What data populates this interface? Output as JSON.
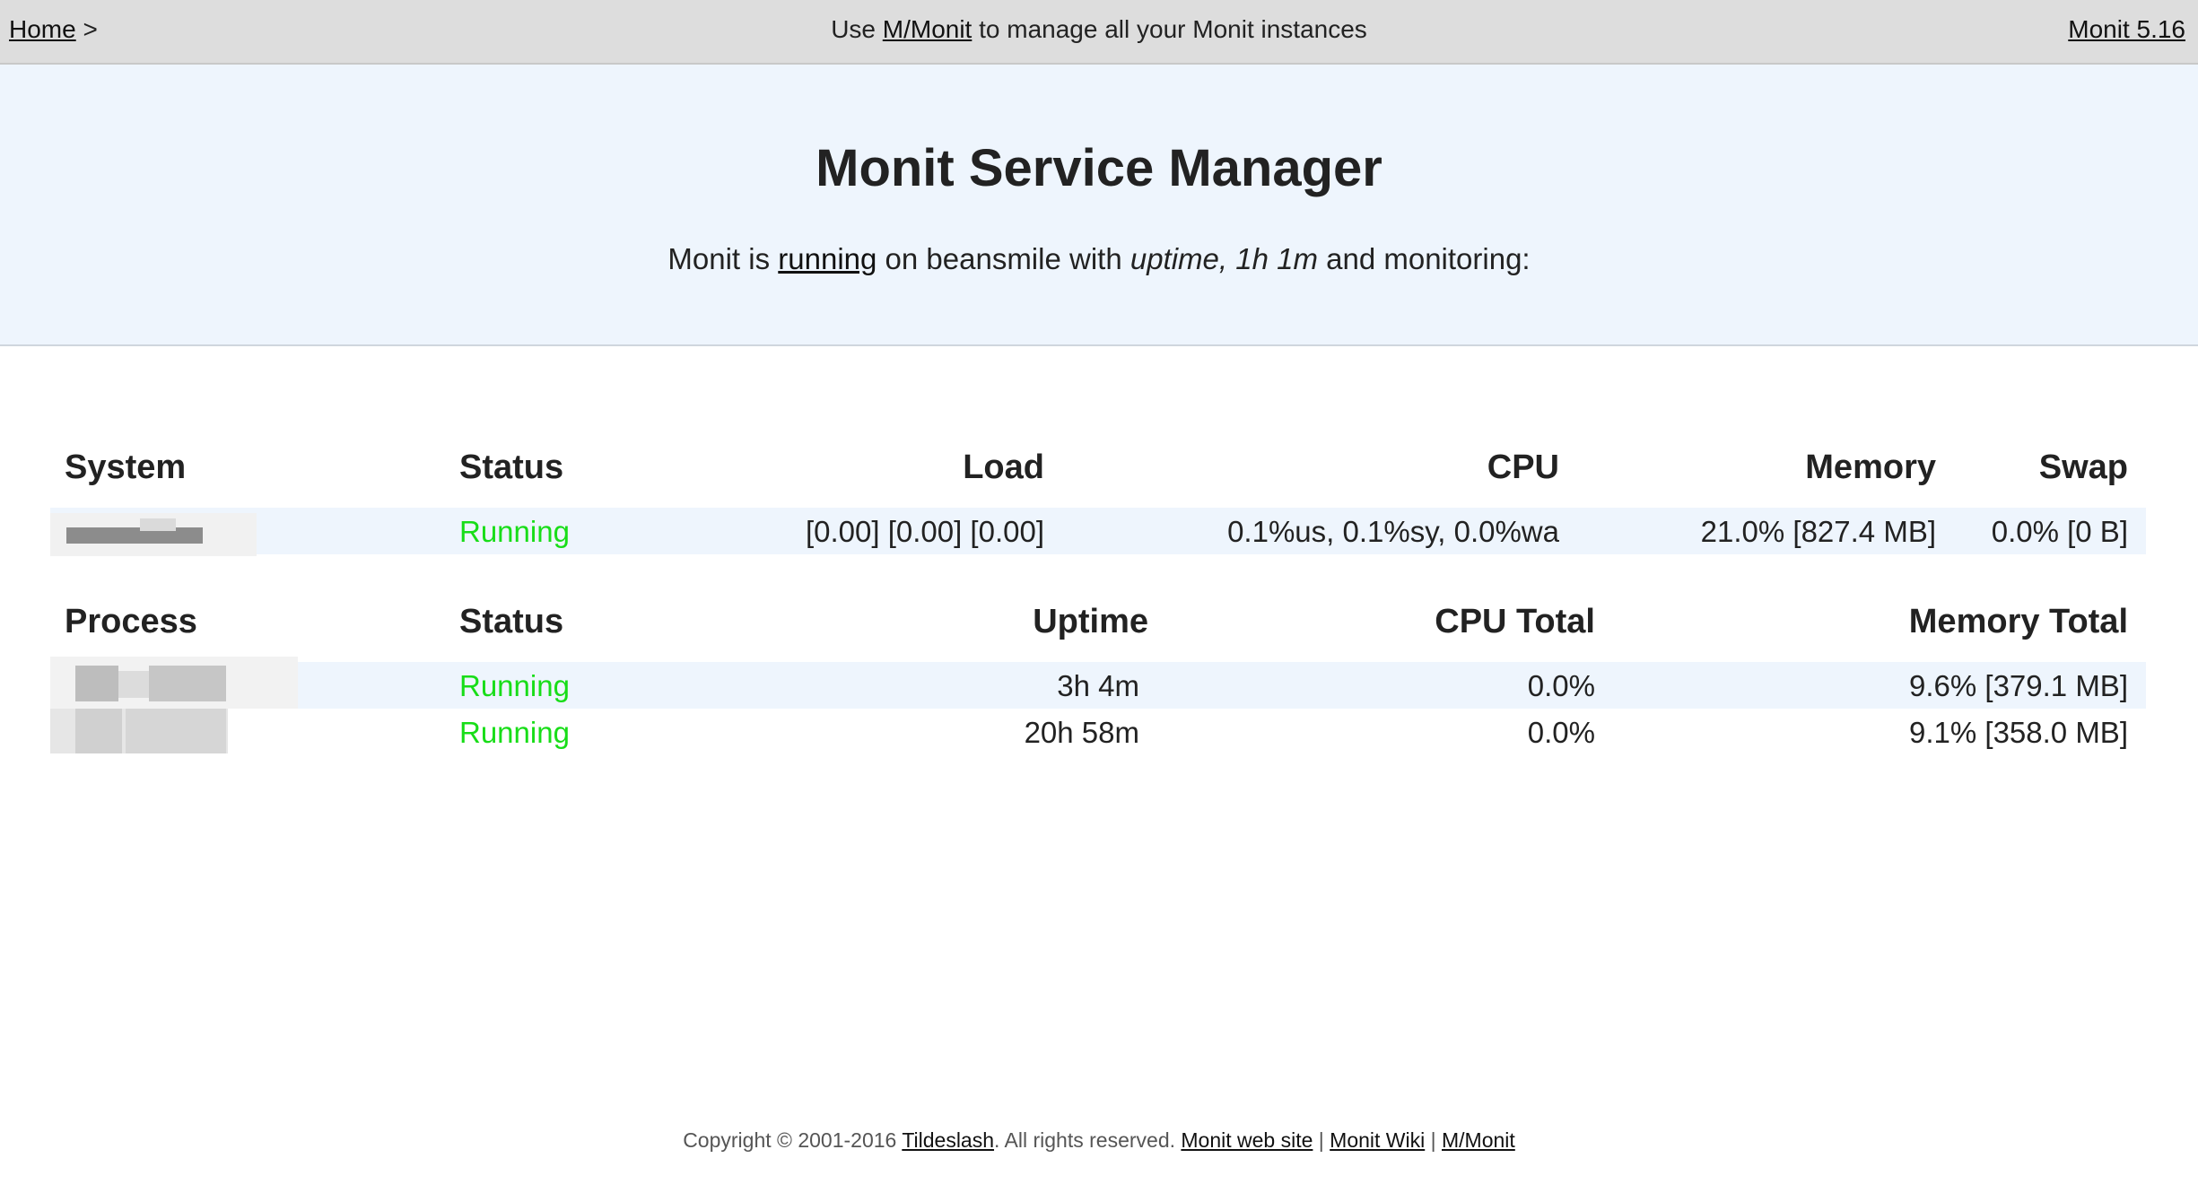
{
  "topbar": {
    "home_link": "Home",
    "home_sep": " >",
    "mmonit_prefix": "Use ",
    "mmonit_link": "M/Monit",
    "mmonit_suffix": " to manage all your Monit instances",
    "version_link": "Monit 5.16"
  },
  "header": {
    "title": "Monit Service Manager",
    "sub_prefix": "Monit is ",
    "sub_status_link": "running",
    "sub_host": " on beansmile with ",
    "sub_uptime": "uptime, 1h 1m",
    "sub_suffix": "  and monitoring:"
  },
  "system_table": {
    "headers": [
      "System",
      "Status",
      "Load",
      "CPU",
      "Memory",
      "Swap"
    ],
    "rows": [
      {
        "status": "Running",
        "load": "[0.00] [0.00] [0.00]",
        "cpu": "0.1%us, 0.1%sy, 0.0%wa",
        "memory": "21.0% [827.4 MB]",
        "swap": "0.0% [0 B]"
      }
    ]
  },
  "process_table": {
    "headers": [
      "Process",
      "Status",
      "Uptime",
      "CPU Total",
      "Memory Total"
    ],
    "rows": [
      {
        "status": "Running",
        "uptime": "3h 4m",
        "cpu_total": "0.0%",
        "memory_total": "9.6% [379.1 MB]"
      },
      {
        "status": "Running",
        "uptime": "20h 58m",
        "cpu_total": "0.0%",
        "memory_total": "9.1% [358.0 MB]"
      }
    ]
  },
  "footer": {
    "copyright": "Copyright © 2001-2016 ",
    "company_link": "Tildeslash",
    "rights": ". All rights reserved.  ",
    "web_site_link": "Monit web site",
    "sep": " | ",
    "wiki_link": "Monit Wiki",
    "mmonit_link": "M/Monit"
  },
  "colors": {
    "running": "#18dd18",
    "topbar_bg": "#dddddd",
    "header_bg": "#eef5fd"
  }
}
